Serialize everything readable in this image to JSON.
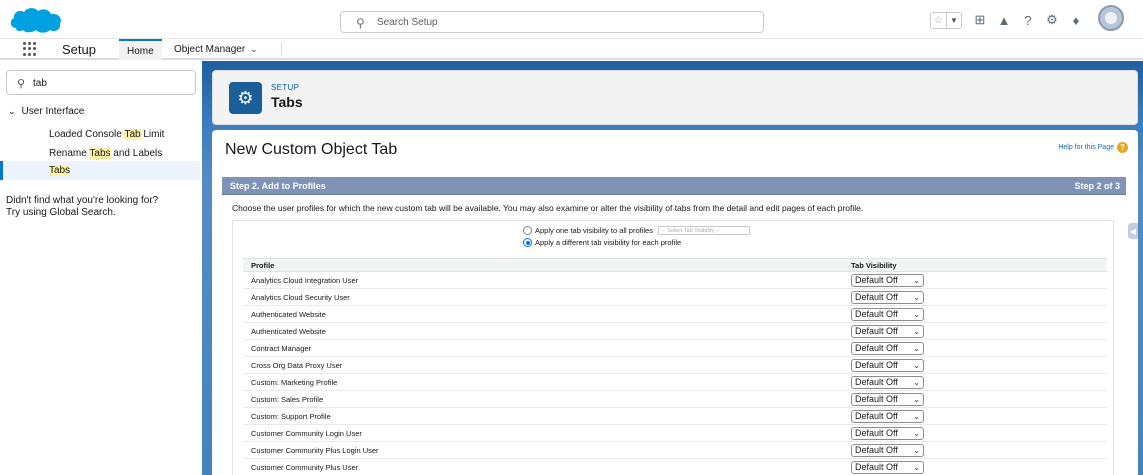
{
  "global_header": {
    "search_placeholder": "Search Setup",
    "icons": [
      "favorites-star-icon",
      "favorites-list-icon",
      "add-icon",
      "trailhead-icon",
      "help-icon",
      "gear-icon",
      "notifications-bell-icon",
      "avatar"
    ]
  },
  "context_bar": {
    "app_name": "Setup",
    "tabs": [
      {
        "label": "Home"
      },
      {
        "label": "Object Manager"
      }
    ]
  },
  "sidebar": {
    "quick_find_value": "tab",
    "group_label": "User Interface",
    "items": [
      {
        "pre": "Loaded Console ",
        "hl": "Tab",
        "post": " Limit"
      },
      {
        "pre": "Rename ",
        "hl": "Tabs",
        "post": " and Labels"
      },
      {
        "pre": "",
        "hl": "Tabs",
        "post": ""
      }
    ],
    "note_line1": "Didn't find what you're looking for?",
    "note_line2": "Try using Global Search."
  },
  "page_header": {
    "kicker": "SETUP",
    "title": "Tabs"
  },
  "panel": {
    "title": "New Custom Object Tab",
    "help_link": "Help for this Page",
    "step_left": "Step 2. Add to Profiles",
    "step_right": "Step 2 of 3",
    "instructions": "Choose the user profiles for which the new custom tab will be available. You may also examine or alter the visibility of tabs from the detail and edit pages of each profile.",
    "radio_all_label": "Apply one tab visibility to all profiles",
    "radio_all_select": "-- Select Tab Visibility --",
    "radio_each_label": "Apply a different tab visibility for each profile",
    "table": {
      "col_profile": "Profile",
      "col_visibility": "Tab Visibility",
      "rows": [
        {
          "profile": "Analytics Cloud Integration User",
          "visibility": "Default Off"
        },
        {
          "profile": "Analytics Cloud Security User",
          "visibility": "Default Off"
        },
        {
          "profile": "Authenticated Website",
          "visibility": "Default Off"
        },
        {
          "profile": "Authenticated Website",
          "visibility": "Default Off"
        },
        {
          "profile": "Contract Manager",
          "visibility": "Default Off"
        },
        {
          "profile": "Cross Org Data Proxy User",
          "visibility": "Default Off"
        },
        {
          "profile": "Custom: Marketing Profile",
          "visibility": "Default Off"
        },
        {
          "profile": "Custom: Sales Profile",
          "visibility": "Default Off"
        },
        {
          "profile": "Custom: Support Profile",
          "visibility": "Default Off"
        },
        {
          "profile": "Customer Community Login User",
          "visibility": "Default Off"
        },
        {
          "profile": "Customer Community Plus Login User",
          "visibility": "Default Off"
        },
        {
          "profile": "Customer Community Plus User",
          "visibility": "Default Off"
        }
      ]
    }
  },
  "colors": {
    "brand_blue": "#0176d3",
    "step_bar": "#7e93b5",
    "header_badge": "#1b5f99",
    "highlight": "#fff1a8"
  }
}
